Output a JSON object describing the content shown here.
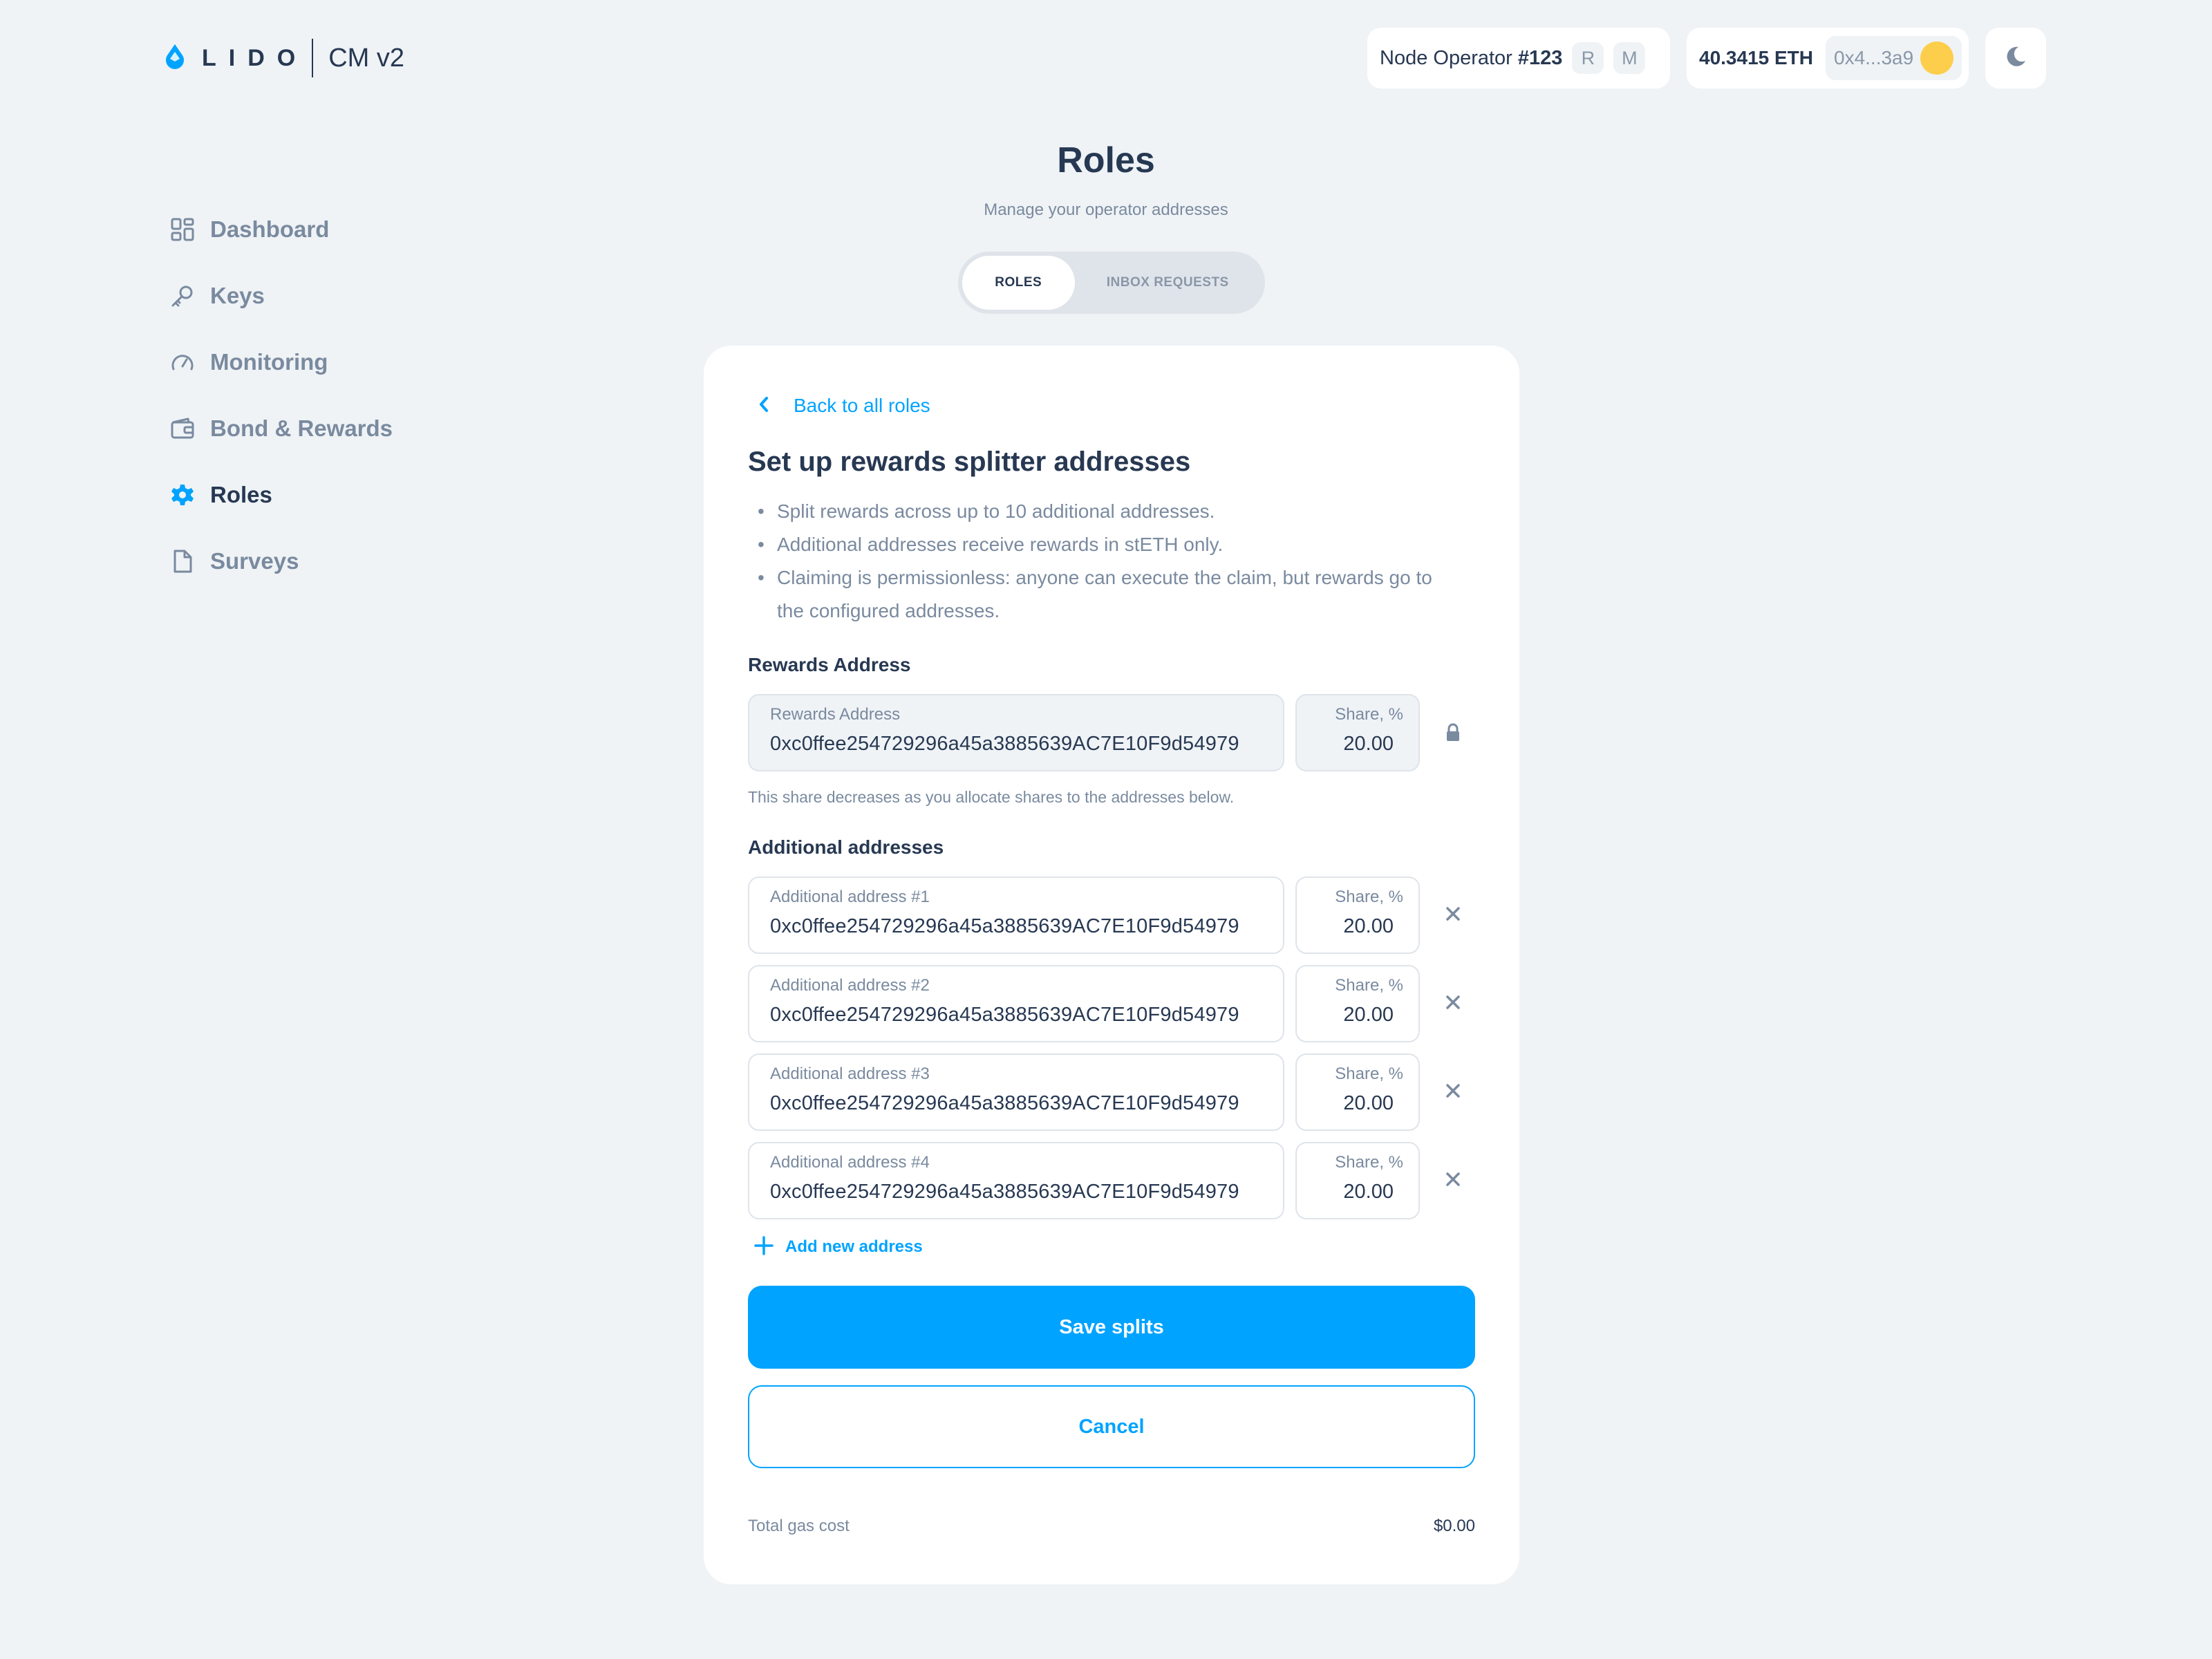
{
  "brand": {
    "wordmark": "LIDO",
    "product": "CM v2",
    "accent_color": "#00a3ff"
  },
  "header": {
    "operator": {
      "label": "Node Operator",
      "number": "#123",
      "roles": [
        "R",
        "M"
      ]
    },
    "wallet": {
      "balance": "40.3415 ETH",
      "address": "0x4...3a9",
      "avatar_color": "#fdce4b"
    },
    "theme_icon": "moon-icon"
  },
  "sidebar": {
    "items": [
      {
        "label": "Dashboard",
        "icon": "dashboard-grid-icon",
        "active": false
      },
      {
        "label": "Keys",
        "icon": "key-icon",
        "active": false
      },
      {
        "label": "Monitoring",
        "icon": "gauge-icon",
        "active": false
      },
      {
        "label": "Bond & Rewards",
        "icon": "wallet-icon",
        "active": false
      },
      {
        "label": "Roles",
        "icon": "gear-icon",
        "active": true
      },
      {
        "label": "Surveys",
        "icon": "document-icon",
        "active": false
      }
    ]
  },
  "page": {
    "title": "Roles",
    "subtitle": "Manage your operator addresses",
    "tabs": [
      {
        "label": "ROLES",
        "active": true
      },
      {
        "label": "INBOX REQUESTS",
        "active": false
      }
    ]
  },
  "card": {
    "back_label": "Back to all roles",
    "title": "Set up rewards splitter addresses",
    "bullets": [
      "Split rewards across up to 10 additional addresses.",
      "Additional addresses receive rewards in stETH only.",
      "Claiming is permissionless: anyone can execute the claim, but rewards go to",
      "the configured addresses."
    ],
    "rewards_section_label": "Rewards Address",
    "rewards": {
      "label": "Rewards Address",
      "value": "0xc0ffee254729296a45a3885639AC7E10F9d54979",
      "share_label": "Share, %",
      "share": "20.00",
      "icon": "lock-icon"
    },
    "share_hint": "This share decreases as you allocate shares to the addresses below.",
    "additional_section_label": "Additional addresses",
    "additional": [
      {
        "label": "Additional address #1",
        "value": "0xc0ffee254729296a45a3885639AC7E10F9d54979",
        "share_label": "Share, %",
        "share": "20.00"
      },
      {
        "label": "Additional address #2",
        "value": "0xc0ffee254729296a45a3885639AC7E10F9d54979",
        "share_label": "Share, %",
        "share": "20.00"
      },
      {
        "label": "Additional address #3",
        "value": "0xc0ffee254729296a45a3885639AC7E10F9d54979",
        "share_label": "Share, %",
        "share": "20.00"
      },
      {
        "label": "Additional address #4",
        "value": "0xc0ffee254729296a45a3885639AC7E10F9d54979",
        "share_label": "Share, %",
        "share": "20.00"
      }
    ],
    "add_label": "Add new address",
    "save_label": "Save splits",
    "cancel_label": "Cancel",
    "gas_label": "Total gas cost",
    "gas_value": "$0.00"
  }
}
